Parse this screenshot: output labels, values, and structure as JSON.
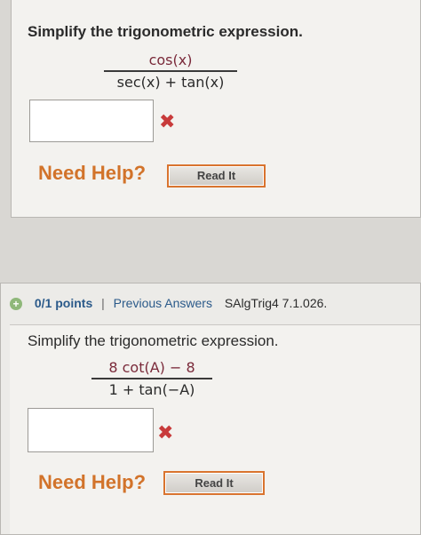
{
  "q1": {
    "prompt": "Simplify the trigonometric expression.",
    "numerator": "cos(x)",
    "denominator": "sec(x) + tan(x)",
    "answer_value": "",
    "result_mark": "✖",
    "need_help": "Need Help?",
    "read_it": "Read It"
  },
  "q2": {
    "points": "0/1 points",
    "separator": "|",
    "previous_answers": "Previous Answers",
    "reference": "SAlgTrig4 7.1.026.",
    "prompt": "Simplify the trigonometric expression.",
    "numerator": "8 cot(A) − 8",
    "denominator": "1 + tan(−A)",
    "answer_value": "",
    "result_mark": "✖",
    "need_help": "Need Help?",
    "read_it": "Read It"
  },
  "colors": {
    "incorrect": "#c83b3b",
    "help": "#d2732a",
    "link": "#2b5a8a"
  }
}
